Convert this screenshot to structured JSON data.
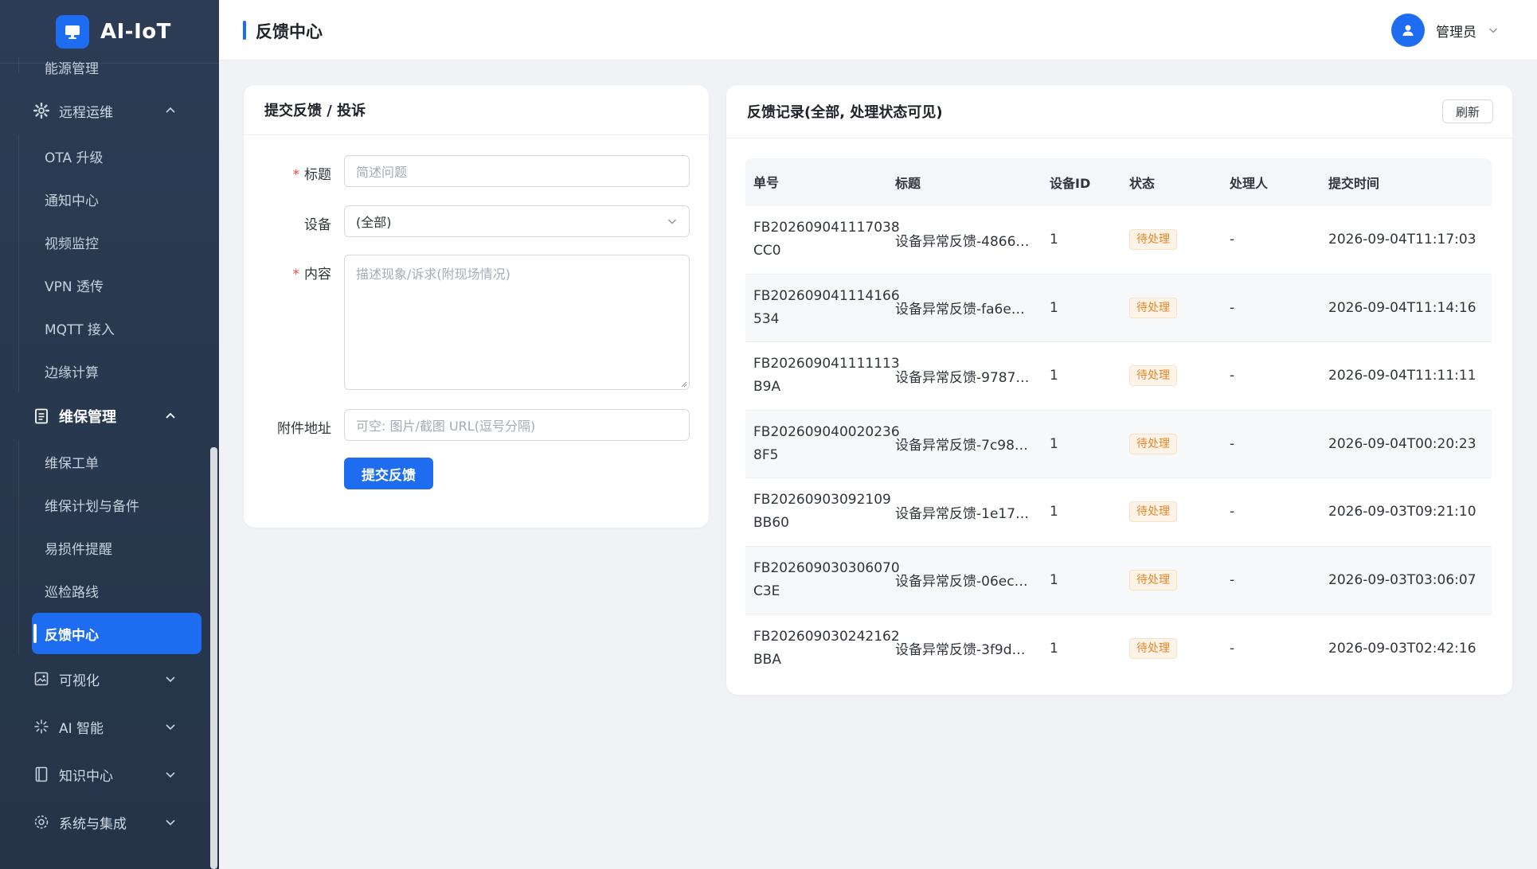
{
  "app": {
    "title": "AI-IoT"
  },
  "sidebar": {
    "top_item": "能源管理",
    "groups": [
      {
        "label": "远程运维",
        "icon": "gear-icon",
        "expanded": true,
        "items": [
          "OTA 升级",
          "通知中心",
          "视频监控",
          "VPN 透传",
          "MQTT 接入",
          "边缘计算"
        ]
      },
      {
        "label": "维保管理",
        "icon": "document-icon",
        "expanded": true,
        "items": [
          "维保工单",
          "维保计划与备件",
          "易损件提醒",
          "巡检路线",
          "反馈中心"
        ],
        "active": "反馈中心"
      },
      {
        "label": "可视化",
        "icon": "image-icon",
        "expanded": false
      },
      {
        "label": "AI 智能",
        "icon": "sparkle-icon",
        "expanded": false
      },
      {
        "label": "知识中心",
        "icon": "book-icon",
        "expanded": false
      },
      {
        "label": "系统与集成",
        "icon": "settings-icon",
        "expanded": false
      }
    ]
  },
  "header": {
    "title": "反馈中心",
    "user": "管理员"
  },
  "form": {
    "title": "提交反馈 / 投诉",
    "title_label": "标题",
    "title_placeholder": "简述问题",
    "device_label": "设备",
    "device_value": "(全部)",
    "content_label": "内容",
    "content_placeholder": "描述现象/诉求(附现场情况)",
    "attachment_label": "附件地址",
    "attachment_placeholder": "可空: 图片/截图 URL(逗号分隔)",
    "submit_label": "提交反馈"
  },
  "records": {
    "title": "反馈记录(全部, 处理状态可见)",
    "refresh_label": "刷新",
    "columns": [
      "单号",
      "标题",
      "设备ID",
      "状态",
      "处理人",
      "提交时间"
    ],
    "rows": [
      {
        "id_line1": "FB202609041117038",
        "id_line2": "CC0",
        "title": "设备异常反馈-4866…",
        "device": "1",
        "status": "待处理",
        "handler": "-",
        "time": "2026-09-04T11:17:03"
      },
      {
        "id_line1": "FB202609041114166",
        "id_line2": "534",
        "title": "设备异常反馈-fa6e…",
        "device": "1",
        "status": "待处理",
        "handler": "-",
        "time": "2026-09-04T11:14:16"
      },
      {
        "id_line1": "FB202609041111113",
        "id_line2": "B9A",
        "title": "设备异常反馈-9787…",
        "device": "1",
        "status": "待处理",
        "handler": "-",
        "time": "2026-09-04T11:11:11"
      },
      {
        "id_line1": "FB202609040020236",
        "id_line2": "8F5",
        "title": "设备异常反馈-7c98…",
        "device": "1",
        "status": "待处理",
        "handler": "-",
        "time": "2026-09-04T00:20:23"
      },
      {
        "id_line1": "FB20260903092109",
        "id_line2": "BB60",
        "title": "设备异常反馈-1e17…",
        "device": "1",
        "status": "待处理",
        "handler": "-",
        "time": "2026-09-03T09:21:10"
      },
      {
        "id_line1": "FB202609030306070",
        "id_line2": "C3E",
        "title": "设备异常反馈-06ec…",
        "device": "1",
        "status": "待处理",
        "handler": "-",
        "time": "2026-09-03T03:06:07"
      },
      {
        "id_line1": "FB202609030242162",
        "id_line2": "BBA",
        "title": "设备异常反馈-3f9d…",
        "device": "1",
        "status": "待处理",
        "handler": "-",
        "time": "2026-09-03T02:42:16"
      }
    ]
  },
  "colors": {
    "primary": "#1e6cf0",
    "sidebar": "#2b3c54",
    "pending": "#e8862a"
  }
}
